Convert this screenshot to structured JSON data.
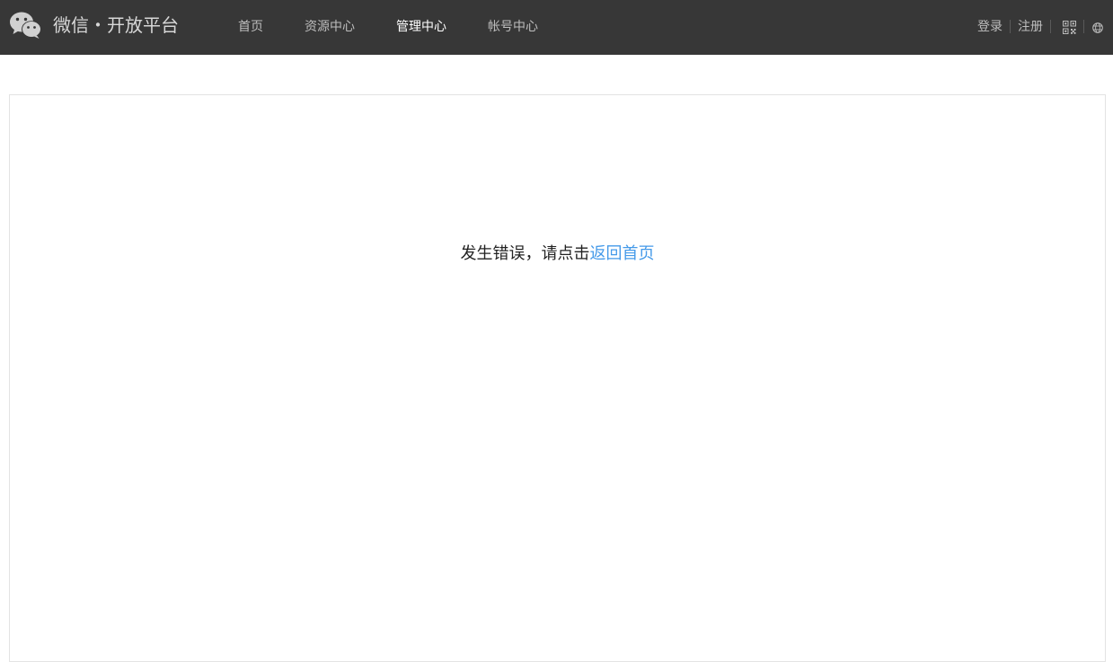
{
  "header": {
    "brand": "微信・开放平台",
    "nav": [
      {
        "label": "首页",
        "active": false
      },
      {
        "label": "资源中心",
        "active": false
      },
      {
        "label": "管理中心",
        "active": true
      },
      {
        "label": "帐号中心",
        "active": false
      }
    ],
    "login_label": "登录",
    "register_label": "注册",
    "icons": [
      "wechat-logo",
      "qr-code-icon",
      "globe-icon"
    ]
  },
  "main": {
    "error_text": "发生错误，请点击",
    "home_link_label": "返回首页"
  },
  "colors": {
    "header_bg": "#373737",
    "link": "#459ae9",
    "nav_text": "#bdbdbd",
    "nav_active": "#ffffff"
  }
}
